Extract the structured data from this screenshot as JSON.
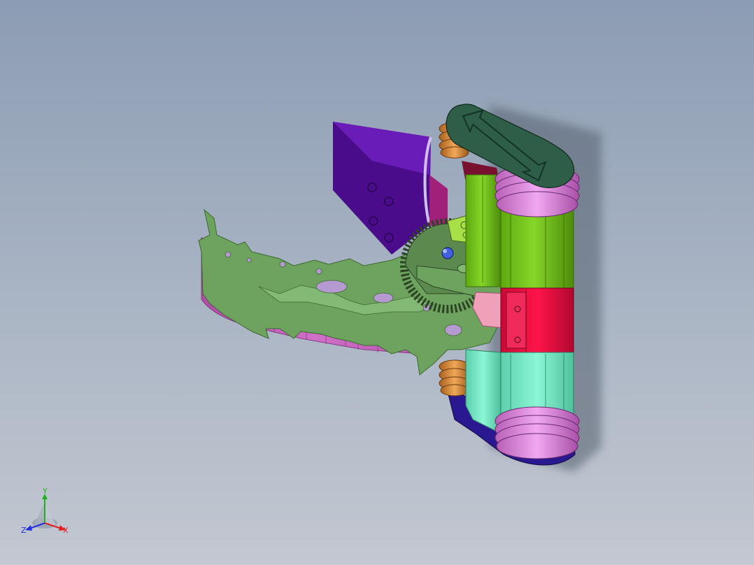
{
  "viewport": {
    "background_top": "#8c9cb3",
    "background_bottom": "#c3c8d1"
  },
  "model": {
    "colors": {
      "purple_plate": "#5a14a0",
      "green_claw": "#6da35f",
      "pink_side": "#c860b8",
      "lime_roller": "#7fd020",
      "red_roller": "#e81040",
      "aqua_roller": "#78ecc8",
      "pink_ring": "#d080d0",
      "dark_green_cap": "#2e5e48",
      "navy_base": "#2a1890",
      "orange_ring": "#d08a3a",
      "gear": "#3e5a32"
    }
  },
  "triad": {
    "x_label": "X",
    "y_label": "Y",
    "z_label": "Z",
    "x_color": "#e02020",
    "y_color": "#20b020",
    "z_color": "#2030e0"
  }
}
